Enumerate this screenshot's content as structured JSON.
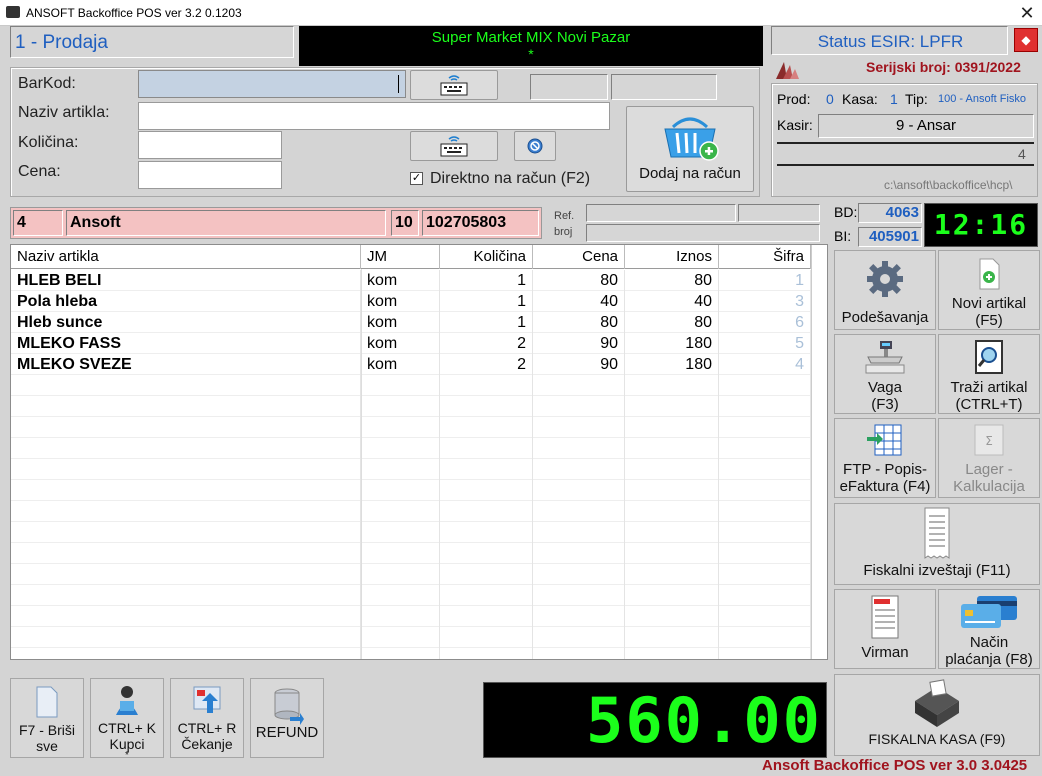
{
  "window": {
    "title": "ANSOFT Backoffice POS ver  3.2 0.1203",
    "close": "✕"
  },
  "mode": {
    "label": "1 - Prodaja"
  },
  "store": {
    "line1": "Super Market MIX Novi Pazar",
    "line2": "*"
  },
  "status": {
    "esir": "Status ESIR: LPFR",
    "serial": "Serijski broj: 0391/2022"
  },
  "info": {
    "prod_label": "Prod:",
    "prod_val": "0",
    "kasa_label": "Kasa:",
    "kasa_val": "1",
    "tip_label": "Tip:",
    "tip_val": "100 - Ansoft Fisko",
    "kasir_label": "Kasir:",
    "kasir_val": "9 - Ansar",
    "small_val": "4",
    "path": "c:\\ansoft\\backoffice\\hcp\\"
  },
  "entry": {
    "barkod": "BarKod:",
    "naziv": "Naziv artikla:",
    "kolicina": "Količina:",
    "cena": "Cena:",
    "direct_check": "✓",
    "direct_label": "Direktno na račun (F2)",
    "add_button": "Dodaj na račun"
  },
  "customer": {
    "code": "4",
    "name": "Ansoft",
    "num": "10",
    "pib": "102705803",
    "ref_label": "Ref.",
    "broj_label": "broj"
  },
  "counters": {
    "bd_label": "BD:",
    "bd_val": "4063",
    "bi_label": "BI:",
    "bi_val": "405901",
    "clock": "12:16"
  },
  "table": {
    "headers": [
      "Naziv artikla",
      "JM",
      "Količina",
      "Cena",
      "Iznos",
      "Šifra"
    ],
    "rows": [
      {
        "naziv": "HLEB BELI",
        "jm": "kom",
        "kolicina": "1",
        "cena": "80",
        "iznos": "80",
        "sifra": "1"
      },
      {
        "naziv": "Pola hleba",
        "jm": "kom",
        "kolicina": "1",
        "cena": "40",
        "iznos": "40",
        "sifra": "3"
      },
      {
        "naziv": "Hleb sunce",
        "jm": "kom",
        "kolicina": "1",
        "cena": "80",
        "iznos": "80",
        "sifra": "6"
      },
      {
        "naziv": "MLEKO FASS",
        "jm": "kom",
        "kolicina": "2",
        "cena": "90",
        "iznos": "180",
        "sifra": "5"
      },
      {
        "naziv": "MLEKO SVEZE",
        "jm": "kom",
        "kolicina": "2",
        "cena": "90",
        "iznos": "180",
        "sifra": "4"
      }
    ]
  },
  "actions": {
    "podesavanja": "Podešavanja",
    "novi_artikal_1": "Novi artikal",
    "novi_artikal_2": "(F5)",
    "vaga_1": "Vaga",
    "vaga_2": "(F3)",
    "trazi_1": "Traži artikal",
    "trazi_2": "(CTRL+T)",
    "ftp_1": "FTP - Popis-",
    "ftp_2": "eFaktura (F4)",
    "lager_1": "Lager -",
    "lager_2": "Kalkulacija",
    "fiskalni": "Fiskalni izveštaji (F11)",
    "virman": "Virman",
    "nacin_1": "Način",
    "nacin_2": "plaćanja (F8)",
    "fiskalna_kasa": "FISKALNA KASA (F9)"
  },
  "bottom": {
    "f7_1": "F7 - Briši",
    "f7_2": "sve",
    "ctrlk_1": "CTRL+ K",
    "ctrlk_2": "Kupci",
    "ctrlk_3": "*",
    "ctrlr_1": "CTRL+ R",
    "ctrlr_2": "Čekanje",
    "refund": "REFUND"
  },
  "total": "560.00",
  "footer": "Ansoft Backoffice POS ver 3.0 3.0425",
  "colors": {
    "accent_blue": "#1f5fc0",
    "lcd_green": "#1bff1b",
    "pink": "#f4c2c2",
    "footer_red": "#a0141e"
  }
}
